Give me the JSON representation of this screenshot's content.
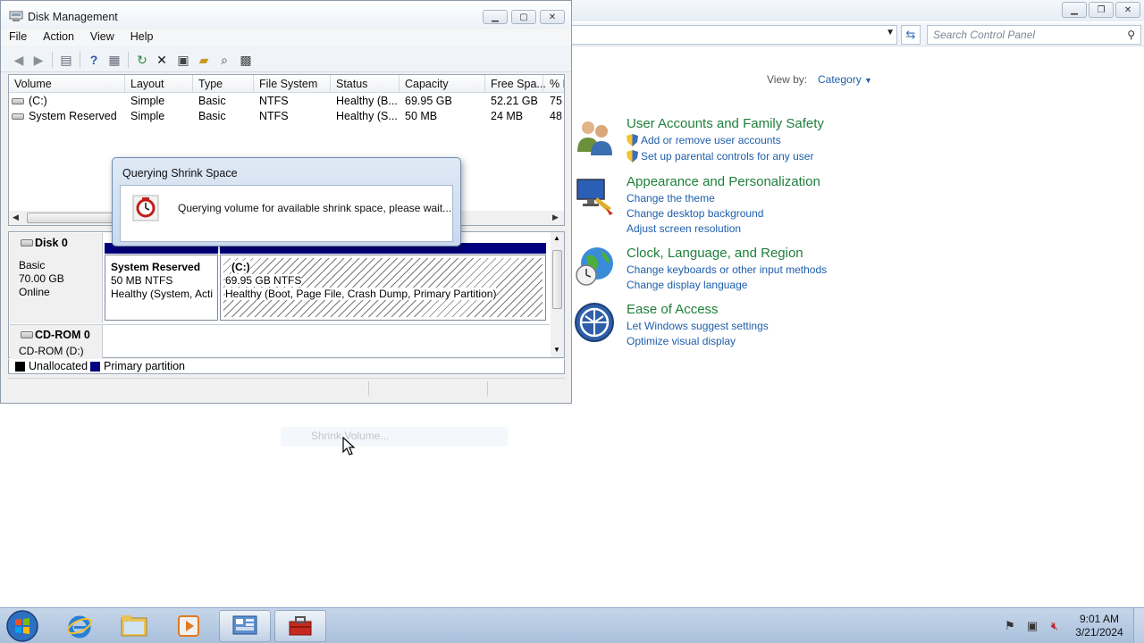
{
  "control_panel": {
    "search_placeholder": "Search Control Panel",
    "view_by_label": "View by:",
    "view_by_value": "Category",
    "categories": [
      {
        "title": "User Accounts and Family Safety",
        "links": [
          "Add or remove user accounts",
          "Set up parental controls for any user"
        ]
      },
      {
        "title": "Appearance and Personalization",
        "links": [
          "Change the theme",
          "Change desktop background",
          "Adjust screen resolution"
        ]
      },
      {
        "title": "Clock, Language, and Region",
        "links": [
          "Change keyboards or other input methods",
          "Change display language"
        ]
      },
      {
        "title": "Ease of Access",
        "links": [
          "Let Windows suggest settings",
          "Optimize visual display"
        ]
      }
    ]
  },
  "disk_management": {
    "title": "Disk Management",
    "menu": [
      "File",
      "Action",
      "View",
      "Help"
    ],
    "columns": [
      "Volume",
      "Layout",
      "Type",
      "File System",
      "Status",
      "Capacity",
      "Free Spa...",
      "% F"
    ],
    "rows": [
      [
        "(C:)",
        "Simple",
        "Basic",
        "NTFS",
        "Healthy (B...",
        "69.95 GB",
        "52.21 GB",
        "75"
      ],
      [
        "System Reserved",
        "Simple",
        "Basic",
        "NTFS",
        "Healthy (S...",
        "50 MB",
        "24 MB",
        "48"
      ]
    ],
    "disks": [
      {
        "name": "Disk 0",
        "type": "Basic",
        "size": "70.00 GB",
        "state": "Online"
      },
      {
        "name": "CD-ROM 0",
        "type": "CD-ROM (D:)"
      }
    ],
    "partitions": [
      {
        "name": "System Reserved",
        "size": "50 MB NTFS",
        "status": "Healthy (System, Acti"
      },
      {
        "name": "(C:)",
        "size": "69.95 GB NTFS",
        "status": "Healthy (Boot, Page File, Crash Dump, Primary Partition)"
      }
    ],
    "legend": [
      "Unallocated",
      "Primary partition"
    ],
    "colors": {
      "unallocated": "#000000",
      "primary": "#000080"
    }
  },
  "dialog": {
    "title": "Querying Shrink Space",
    "message": "Querying volume for available shrink space, please wait..."
  },
  "context_ghost": "Shrink Volume...",
  "taskbar": {
    "time": "9:01 AM",
    "date": "3/21/2024"
  }
}
